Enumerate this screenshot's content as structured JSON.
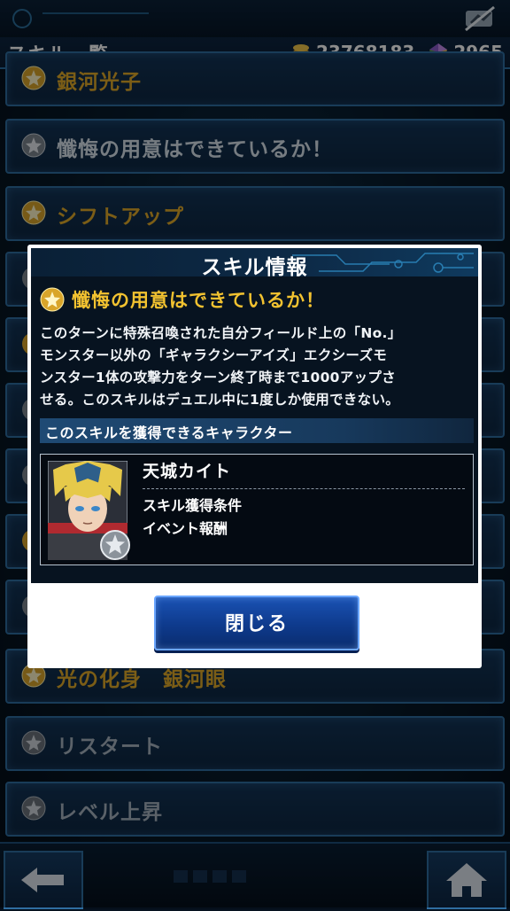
{
  "header": {
    "page_title": "スキル一覧",
    "coins": "23768183",
    "gems": "2965"
  },
  "skill_list": [
    {
      "label": "銀河光子",
      "icon": "gold-star-icon",
      "style": "gold"
    },
    {
      "label": "懺悔の用意はできているか！",
      "icon": "silver-star-icon",
      "style": "normal"
    },
    {
      "label": "シフトアップ",
      "icon": "gold-star-icon",
      "style": "gold"
    },
    {
      "label": "光の化身　銀河眼",
      "icon": "gold-star-icon",
      "style": "gold"
    },
    {
      "label": "リスタート",
      "icon": "silver-star-icon",
      "style": "dim"
    },
    {
      "label": "レベル上昇",
      "icon": "silver-star-icon",
      "style": "dim"
    }
  ],
  "modal": {
    "title": "スキル情報",
    "skill_name": "懺悔の用意はできているか！",
    "description_lines": [
      "このターンに特殊召喚された自分フィールド上の「No.」",
      "モンスター以外の「ギャラクシーアイズ」エクシーズモ",
      "ンスター1体の攻撃力をターン終了時まで1000アップさ",
      "せる。このスキルはデュエル中に1度しか使用できない。"
    ],
    "section_label": "このスキルを獲得できるキャラクター",
    "character": {
      "name": "天城カイト",
      "condition_label": "スキル獲得条件",
      "condition_value": "イベント報酬"
    },
    "close_label": "閉じる"
  },
  "colors": {
    "gold_text": "#e0a929",
    "skill_title": "#f2c230",
    "button_blue": "#1a52b4"
  }
}
